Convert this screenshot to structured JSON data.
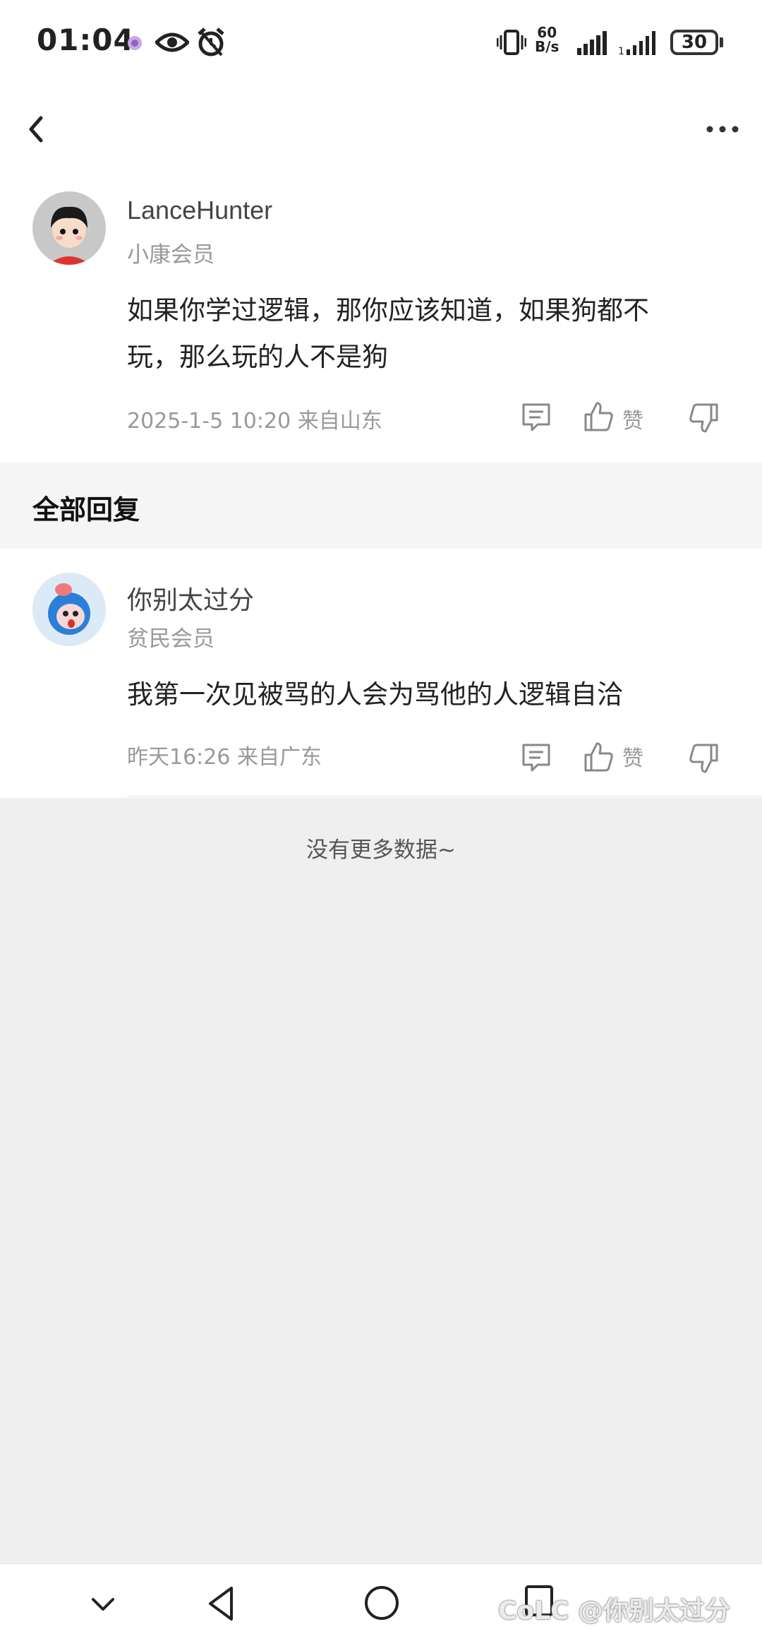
{
  "status_bar": {
    "time": "01:04",
    "net_speed_value": "60",
    "net_speed_unit": "B/s",
    "battery": "30",
    "icons": [
      "notification-icon",
      "eye-icon",
      "alarm-icon",
      "vibrate-icon",
      "signal-icon",
      "signal-icon-2"
    ]
  },
  "nav": {
    "back_icon": "chevron-left-icon",
    "more_icon": "more-horizontal-icon"
  },
  "post": {
    "username": "LanceHunter",
    "member_level": "小康会员",
    "content_line1": "如果你学过逻辑，那你应该知道，如果狗都不",
    "content_line2": "玩，那么玩的人不是狗",
    "meta": "2025-1-5 10:20  来自山东",
    "like_label": "赞"
  },
  "section": {
    "title": "全部回复"
  },
  "reply": {
    "username": "你别太过分",
    "member_level": "贫民会员",
    "content": "我第一次见被骂的人会为骂他的人逻辑自洽",
    "meta": "昨天16:26 来自广东",
    "like_label": "赞"
  },
  "footer": {
    "no_more": "没有更多数据~"
  },
  "watermark": "CoLC @你别太过分",
  "colors": {
    "text_primary": "#222222",
    "text_secondary": "#999999",
    "background": "#efefef"
  }
}
